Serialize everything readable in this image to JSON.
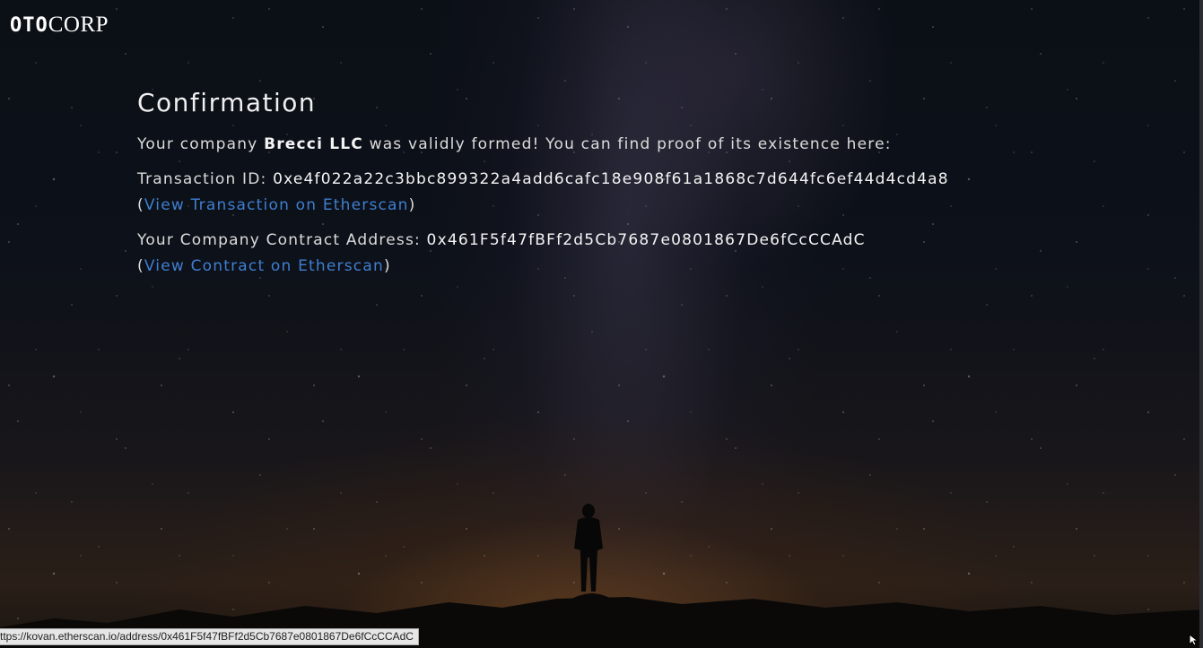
{
  "logo": {
    "part1": "OTO",
    "part2": "CORP"
  },
  "confirmation": {
    "title": "Confirmation",
    "intro_prefix": "Your company ",
    "company_name": "Brecci LLC",
    "intro_suffix": " was validly formed! You can find proof of its existence here:",
    "transaction_label": "Transaction ID: ",
    "transaction_id": "0xe4f022a22c3bbc899322a4add6cafc18e908f61a1868c7d644fc6ef44d4cd4a8",
    "transaction_link_text": "View Transaction on Etherscan",
    "contract_label": "Your Company Contract Address: ",
    "contract_address": "0x461F5f47fBFf2d5Cb7687e0801867De6fCcCCAdC",
    "contract_link_text": "View Contract on Etherscan",
    "paren_open": "(",
    "paren_close": ")"
  },
  "statusbar": {
    "url": "ttps://kovan.etherscan.io/address/0x461F5f47fBFf2d5Cb7687e0801867De6fCcCCAdC"
  },
  "colors": {
    "link": "#3f7fd1",
    "text": "#dcdcdc",
    "background_top": "#0b0f16",
    "horizon_glow": "#784a22"
  },
  "icons": {
    "cursor": "resize-cursor-icon"
  }
}
